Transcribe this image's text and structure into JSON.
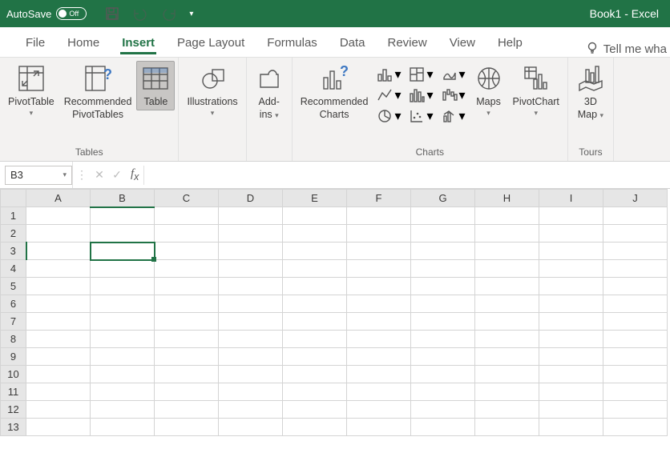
{
  "titlebar": {
    "autosave_label": "AutoSave",
    "autosave_state": "Off",
    "window_title": "Book1  -  Excel"
  },
  "tabs": [
    "File",
    "Home",
    "Insert",
    "Page Layout",
    "Formulas",
    "Data",
    "Review",
    "View",
    "Help"
  ],
  "active_tab": "Insert",
  "tellme": "Tell me wha",
  "ribbon": {
    "tables": {
      "label": "Tables",
      "pivot": "PivotTable",
      "recommended_pivot_l1": "Recommended",
      "recommended_pivot_l2": "PivotTables",
      "table": "Table"
    },
    "illustrations": {
      "label": "Illustrations"
    },
    "addins": {
      "label_l1": "Add-",
      "label_l2": "ins"
    },
    "charts": {
      "label": "Charts",
      "recommended_l1": "Recommended",
      "recommended_l2": "Charts"
    },
    "maps": "Maps",
    "pivotchart": "PivotChart",
    "tours": {
      "group": "Tours",
      "map3d_l1": "3D",
      "map3d_l2": "Map"
    }
  },
  "formula_bar": {
    "name_box": "B3",
    "formula": ""
  },
  "grid": {
    "columns": [
      "A",
      "B",
      "C",
      "D",
      "E",
      "F",
      "G",
      "H",
      "I",
      "J"
    ],
    "row_count": 13,
    "selected": "B3"
  },
  "colors": {
    "brand": "#217346"
  }
}
